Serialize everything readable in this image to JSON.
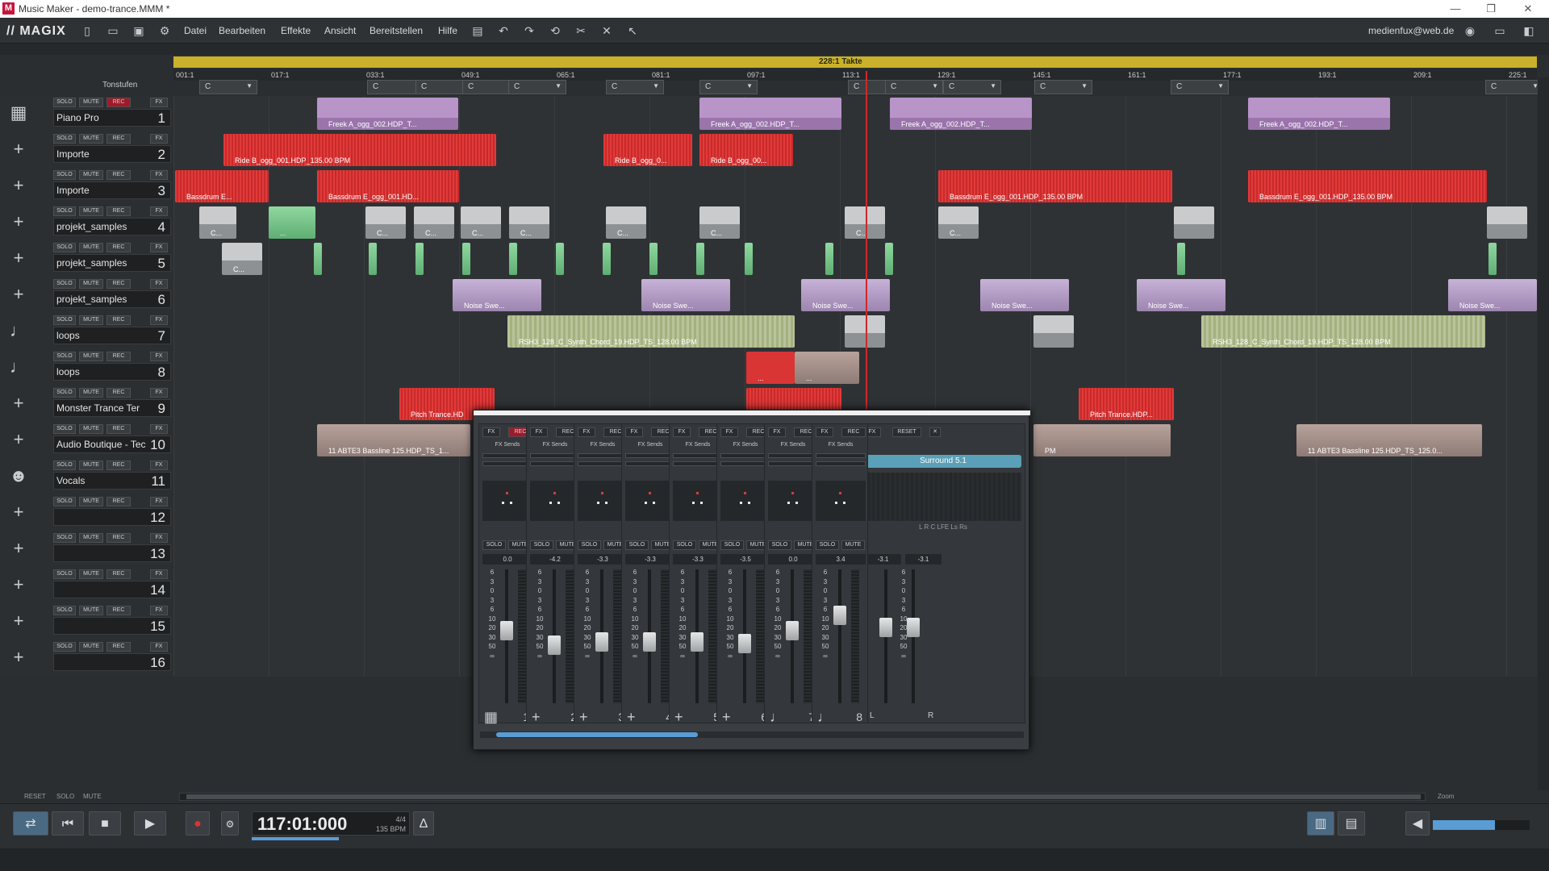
{
  "window": {
    "title": "Music Maker - demo-trance.MMM *"
  },
  "menubar": {
    "logo": "// MAGIX",
    "items": [
      "Datei",
      "Bearbeiten",
      "Effekte",
      "Ansicht",
      "Bereitstellen",
      "Hilfe"
    ],
    "user": "medienfux@web.de"
  },
  "ruler": {
    "label": "228:1 Takte",
    "markers": [
      "001:1",
      "017:1",
      "033:1",
      "049:1",
      "065:1",
      "081:1",
      "097:1",
      "113:1",
      "129:1",
      "145:1",
      "161:1",
      "177:1",
      "193:1",
      "209:1",
      "225:1"
    ]
  },
  "header": {
    "label": "Tonstufen"
  },
  "chords": [
    "C",
    "C",
    "C",
    "C",
    "C",
    "C",
    "C",
    "C",
    "C",
    "C",
    "C",
    "C",
    "C"
  ],
  "track_buttons": {
    "solo": "SOLO",
    "mute": "MUTE",
    "rec": "REC",
    "fx": "FX"
  },
  "tracks": [
    {
      "name": "Piano Pro",
      "number": "1",
      "objects": [
        {
          "label": "Freek A_ogg_002.HDP_T...",
          "color": "purple"
        },
        {
          "label": "Freek A_ogg_002.HDP_T...",
          "color": "purple"
        },
        {
          "label": "Freek A_ogg_002.HDP_T...",
          "color": "purple"
        },
        {
          "label": "Freek A_ogg_002.HDP_T...",
          "color": "purple"
        }
      ]
    },
    {
      "name": "Importe",
      "number": "2",
      "objects": [
        {
          "label": "Ride B_ogg_001.HDP_135.00 BPM",
          "color": "red"
        },
        {
          "label": "Ride B_ogg_0...",
          "color": "red"
        },
        {
          "label": "Ride B_ogg_00...",
          "color": "red"
        }
      ]
    },
    {
      "name": "Importe",
      "number": "3",
      "objects": [
        {
          "label": "Bassdrum E...",
          "color": "red"
        },
        {
          "label": "Bassdrum E_ogg_001.HD...",
          "color": "red"
        },
        {
          "label": "Bassdrum E_ogg_001.HDP_135.00 BPM",
          "color": "red"
        },
        {
          "label": "Bassdrum E_ogg_001.HDP_135.00 BPM",
          "color": "red"
        }
      ]
    },
    {
      "name": "projekt_samples",
      "number": "4",
      "objects": [
        {
          "label": "C...",
          "color": "gray"
        },
        {
          "label": "...",
          "color": "green"
        },
        {
          "label": "C...",
          "color": "gray"
        },
        {
          "label": "C...",
          "color": "gray"
        },
        {
          "label": "C...",
          "color": "gray"
        },
        {
          "label": "C...",
          "color": "gray"
        },
        {
          "label": "C...",
          "color": "gray"
        },
        {
          "label": "C...",
          "color": "gray"
        },
        {
          "label": "C...",
          "color": "gray"
        },
        {
          "label": "C...",
          "color": "gray"
        },
        {
          "label": "",
          "color": "gray"
        },
        {
          "label": "",
          "color": "gray"
        }
      ]
    },
    {
      "name": "projekt_samples",
      "number": "5",
      "objects": [
        {
          "label": "C...",
          "color": "gray"
        }
      ]
    },
    {
      "name": "projekt_samples",
      "number": "6",
      "objects": [
        {
          "label": "Noise Swe...",
          "color": "lilac"
        },
        {
          "label": "Noise Swe...",
          "color": "lilac"
        },
        {
          "label": "Noise Swe...",
          "color": "lilac"
        },
        {
          "label": "Noise Swe...",
          "color": "lilac"
        },
        {
          "label": "Noise Swe...",
          "color": "lilac"
        },
        {
          "label": "Noise Swe...",
          "color": "lilac"
        }
      ]
    },
    {
      "name": "loops",
      "number": "7",
      "objects": [
        {
          "label": "RSH3_128_C_Synth_Chord_19.HDP_TS_128.00 BPM",
          "color": "olive"
        },
        {
          "label": "",
          "color": "gray"
        },
        {
          "label": "",
          "color": "gray"
        },
        {
          "label": "RSH3_128_C_Synth_Chord_19.HDP_TS_128.00 BPM",
          "color": "olive"
        }
      ]
    },
    {
      "name": "loops",
      "number": "8",
      "objects": [
        {
          "label": "...",
          "color": "redsolid"
        },
        {
          "label": "...",
          "color": "tan"
        }
      ]
    },
    {
      "name": "Monster Trance Ter",
      "number": "9",
      "objects": [
        {
          "label": "Pitch Trance.HD",
          "color": "red"
        },
        {
          "label": "",
          "color": "red"
        },
        {
          "label": "Pitch Trance.HDP...",
          "color": "red"
        }
      ]
    },
    {
      "name": "Audio Boutique - Tec",
      "number": "10",
      "objects": [
        {
          "label": "11 ABTE3 Bassline 125.HDP_TS_1...",
          "color": "tan"
        },
        {
          "label": "PM",
          "color": "tan"
        },
        {
          "label": "11 ABTE3 Bassline 125.HDP_TS_125.0...",
          "color": "tan"
        }
      ]
    },
    {
      "name": "Vocals",
      "number": "11",
      "objects": []
    },
    {
      "name": "",
      "number": "12",
      "objects": []
    },
    {
      "name": "",
      "number": "13",
      "objects": []
    },
    {
      "name": "",
      "number": "14",
      "objects": []
    },
    {
      "name": "",
      "number": "15",
      "objects": []
    },
    {
      "name": "",
      "number": "16",
      "objects": []
    }
  ],
  "mixer": {
    "strip_buttons": {
      "fx": "FX",
      "rec": "REC",
      "fx_sends": "FX Sends",
      "solo": "SOLO",
      "mute": "MUTE"
    },
    "scale": [
      "6",
      "3",
      "0",
      "3",
      "6",
      "10",
      "20",
      "30",
      "50",
      "∞"
    ],
    "strips": [
      {
        "number": "1",
        "db": "0.0",
        "level": 0.55
      },
      {
        "number": "2",
        "db": "-4.2",
        "level": 0.42
      },
      {
        "number": "3",
        "db": "-3.3",
        "level": 0.45
      },
      {
        "number": "4",
        "db": "-3.3",
        "level": 0.45
      },
      {
        "number": "5",
        "db": "-3.3",
        "level": 0.45
      },
      {
        "number": "6",
        "db": "-3.5",
        "level": 0.44
      },
      {
        "number": "7",
        "db": "0.0",
        "level": 0.55
      },
      {
        "number": "8",
        "db": "3.4",
        "level": 0.68
      }
    ],
    "master": {
      "fx": "FX",
      "reset": "RESET",
      "surround": "Surround 5.1",
      "channels": "L R C LFE Ls Rs",
      "db_l": "-3.1",
      "db_r": "-3.1",
      "left": "L",
      "right": "R"
    }
  },
  "bottom": {
    "reset": "RESET",
    "solo": "SOLO",
    "mute": "MUTE",
    "zoom": "Zoom"
  },
  "transport": {
    "time": "117:01:000",
    "signature": "4/4",
    "bpm": "135 BPM"
  }
}
